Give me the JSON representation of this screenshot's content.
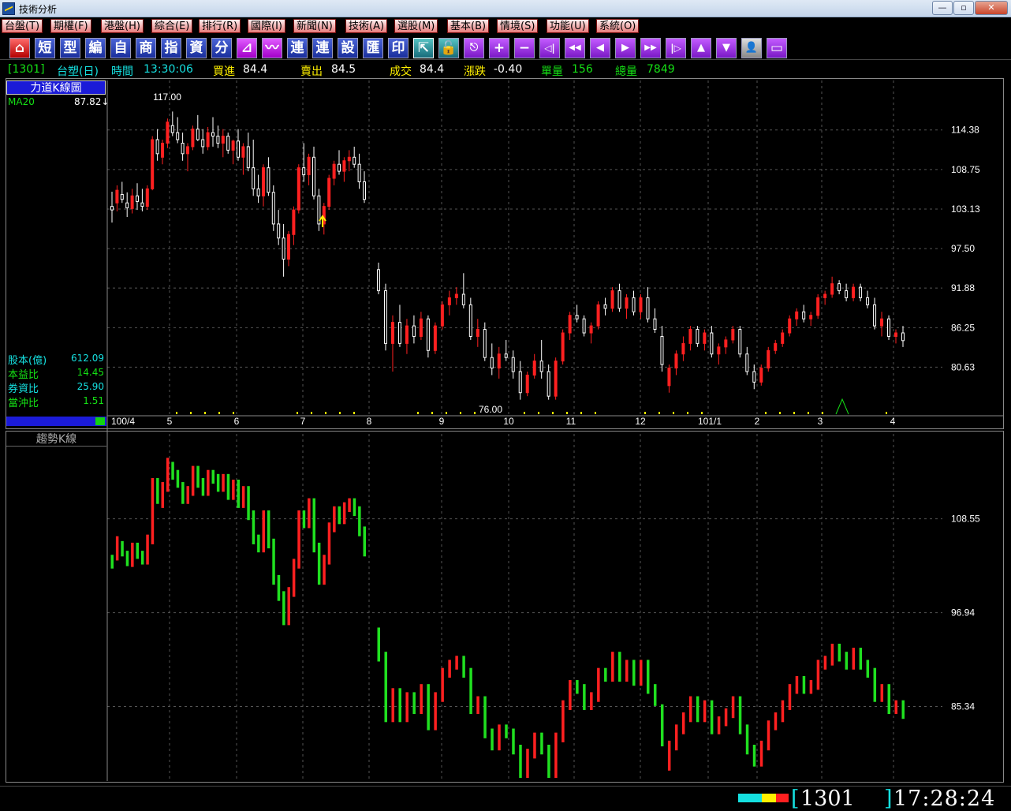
{
  "window": {
    "title": "技術分析",
    "btn_min": "—",
    "btn_max": "▫",
    "btn_close": "✕"
  },
  "menu": [
    "台盤(T)",
    "期權(F)",
    "港盤(H)",
    "綜合(E)",
    "排行(R)",
    "國際(I)",
    "新聞(N)",
    "技術(A)",
    "選股(M)",
    "基本(B)",
    "情境(S)",
    "功能(U)",
    "系統(O)"
  ],
  "toolbar": {
    "home_icon": "⌂",
    "short": "短",
    "type": "型",
    "edit": "編",
    "self": "自",
    "biz": "商",
    "index": "指",
    "capital": "資",
    "split": "分",
    "chart_icon": "⊿",
    "wave_icon": "〰",
    "link1": "連",
    "link2": "連",
    "setting": "設",
    "export": "匯",
    "print": "印",
    "restore_icon": "⇱",
    "lock_icon": "🔓",
    "esc_icon": "⎋",
    "zoom_in": "+",
    "zoom_out": "−",
    "first": "◁|",
    "fast_back": "◀◀",
    "back": "◀",
    "fwd": "▶",
    "fast_fwd": "▶▶",
    "last": "|▷",
    "up": "▲",
    "down": "▼",
    "person_icon": "👤",
    "window_icon": "▭"
  },
  "quote": {
    "code_bracket": "[1301]",
    "name": "台塑(日)",
    "time_label": "時間",
    "time": "13:30:06",
    "bid_label": "買進",
    "bid": "84.4",
    "ask_label": "賣出",
    "ask": "84.5",
    "deal_label": "成交",
    "deal": "84.4",
    "change_label": "漲跌",
    "change": "-0.40",
    "vol_label": "單量",
    "vol": "156",
    "total_label": "總量",
    "total": "7849"
  },
  "upper": {
    "title": "力道K線圖",
    "ma_label": "MA20",
    "ma_value": "87.82↓",
    "stats": [
      {
        "label": "股本(億)",
        "value": "612.09"
      },
      {
        "label": "本益比",
        "value": "14.45"
      },
      {
        "label": "券資比",
        "value": "25.90"
      },
      {
        "label": "當沖比",
        "value": "1.51"
      }
    ]
  },
  "lower": {
    "title": "趨勢K線"
  },
  "status": {
    "code": "1301",
    "time": "17:28:24",
    "bracket_open": "[",
    "bracket_close": "]"
  },
  "colors": {
    "up": "#ff2020",
    "down": "#ffffff",
    "trend_down": "#20e020",
    "ma": "#15e015",
    "grid": "#555555",
    "axis_text": "#ffffff"
  },
  "chart_data": [
    {
      "type": "candlestick",
      "title": "力道K線圖",
      "ylim": [
        74.5,
        119.4
      ],
      "yticks": [
        114.38,
        108.75,
        103.13,
        97.5,
        91.88,
        86.25,
        80.63
      ],
      "ytick_labels": [
        "114.38",
        "108.75",
        "103.13",
        "97.50",
        "91.88",
        "86.25",
        "80.63"
      ],
      "xticks": [
        "100/4",
        "5",
        "6",
        "7",
        "8",
        "9",
        "10",
        "11",
        "12",
        "101/1",
        "2",
        "3",
        "4"
      ],
      "annotations": [
        {
          "text": "117.00",
          "x": "100/5",
          "y": 117.0
        },
        {
          "text": "76.00",
          "x": "100/10",
          "y": 76.0
        }
      ],
      "series": [
        {
          "name": "MA20",
          "last": 87.82
        }
      ],
      "ohlc_approx": [
        [
          103.5,
          105.6,
          101.2,
          103.0
        ],
        [
          104.0,
          106.5,
          102.8,
          105.8
        ],
        [
          105.2,
          107.0,
          104.0,
          104.5
        ],
        [
          104.0,
          105.5,
          102.0,
          103.3
        ],
        [
          103.2,
          106.0,
          102.5,
          105.0
        ],
        [
          105.0,
          106.8,
          103.0,
          104.2
        ],
        [
          104.0,
          106.0,
          102.8,
          103.5
        ],
        [
          103.5,
          106.5,
          103.0,
          106.0
        ],
        [
          106.0,
          113.5,
          105.8,
          113.0
        ],
        [
          113.0,
          114.5,
          110.0,
          111.0
        ],
        [
          110.5,
          113.0,
          109.5,
          112.5
        ],
        [
          112.5,
          116.0,
          111.8,
          115.5
        ],
        [
          115.0,
          117.0,
          113.5,
          114.0
        ],
        [
          114.0,
          116.2,
          112.5,
          113.0
        ],
        [
          112.5,
          114.0,
          110.0,
          111.0
        ],
        [
          111.0,
          112.5,
          108.5,
          112.0
        ],
        [
          112.0,
          115.0,
          111.5,
          114.5
        ],
        [
          114.5,
          116.5,
          112.8,
          113.0
        ],
        [
          113.0,
          114.5,
          111.0,
          112.0
        ],
        [
          112.0,
          114.8,
          111.5,
          114.0
        ],
        [
          114.0,
          116.2,
          112.0,
          113.5
        ],
        [
          113.5,
          115.0,
          111.8,
          112.5
        ],
        [
          112.5,
          114.5,
          110.5,
          113.5
        ],
        [
          113.5,
          114.0,
          111.0,
          111.5
        ],
        [
          111.5,
          113.0,
          109.5,
          112.8
        ],
        [
          112.8,
          114.5,
          110.0,
          110.5
        ],
        [
          110.5,
          112.5,
          108.0,
          112.0
        ],
        [
          112.0,
          114.0,
          108.5,
          109.0
        ],
        [
          109.0,
          113.0,
          105.0,
          106.0
        ],
        [
          106.0,
          108.0,
          104.0,
          105.0
        ],
        [
          105.0,
          109.5,
          103.5,
          109.0
        ],
        [
          109.0,
          110.5,
          105.0,
          105.5
        ],
        [
          105.5,
          106.5,
          100.0,
          101.0
        ],
        [
          101.0,
          103.0,
          98.0,
          99.0
        ],
        [
          99.0,
          101.0,
          93.5,
          96.0
        ],
        [
          96.0,
          100.0,
          95.0,
          99.5
        ],
        [
          99.5,
          103.5,
          98.0,
          103.0
        ],
        [
          103.0,
          109.5,
          102.5,
          109.0
        ],
        [
          109.0,
          112.5,
          107.0,
          108.0
        ],
        [
          108.0,
          111.0,
          106.5,
          110.5
        ],
        [
          110.5,
          112.0,
          104.5,
          105.0
        ],
        [
          105.0,
          106.0,
          100.0,
          101.0
        ],
        [
          101.0,
          104.0,
          99.5,
          103.5
        ],
        [
          103.5,
          108.0,
          103.0,
          107.5
        ],
        [
          107.5,
          110.0,
          106.5,
          109.5
        ],
        [
          109.5,
          111.5,
          108.0,
          108.5
        ],
        [
          108.5,
          110.5,
          107.0,
          110.0
        ],
        [
          110.0,
          111.5,
          108.5,
          110.5
        ],
        [
          110.5,
          112.0,
          109.0,
          109.5
        ],
        [
          109.5,
          111.0,
          106.0,
          107.0
        ],
        [
          107.0,
          108.5,
          104.0,
          104.5
        ],
        [
          94.5,
          95.5,
          91.0,
          91.5
        ],
        [
          91.5,
          92.5,
          83.0,
          84.0
        ],
        [
          84.0,
          88.0,
          80.0,
          87.0
        ],
        [
          87.0,
          89.5,
          83.5,
          84.0
        ],
        [
          84.0,
          87.5,
          82.5,
          86.5
        ],
        [
          86.5,
          88.0,
          84.0,
          85.0
        ],
        [
          85.0,
          88.5,
          84.5,
          87.5
        ],
        [
          87.5,
          88.0,
          82.0,
          83.0
        ],
        [
          83.0,
          87.0,
          82.5,
          86.5
        ],
        [
          86.5,
          90.0,
          86.0,
          89.5
        ],
        [
          89.5,
          91.5,
          88.0,
          90.5
        ],
        [
          90.5,
          92.0,
          89.5,
          91.0
        ],
        [
          91.0,
          94.0,
          89.0,
          89.5
        ],
        [
          89.5,
          90.5,
          84.5,
          85.0
        ],
        [
          85.0,
          87.5,
          83.5,
          86.0
        ],
        [
          86.0,
          87.0,
          81.5,
          82.0
        ],
        [
          82.0,
          84.0,
          79.5,
          80.5
        ],
        [
          80.5,
          83.5,
          79.0,
          82.5
        ],
        [
          82.5,
          84.5,
          81.5,
          82.0
        ],
        [
          82.0,
          83.0,
          79.0,
          80.0
        ],
        [
          80.0,
          81.5,
          76.0,
          77.0
        ],
        [
          77.0,
          80.0,
          76.5,
          79.5
        ],
        [
          79.5,
          82.5,
          79.0,
          81.5
        ],
        [
          81.5,
          84.5,
          79.0,
          80.0
        ],
        [
          80.0,
          81.0,
          76.0,
          76.5
        ],
        [
          76.5,
          82.0,
          76.0,
          81.5
        ],
        [
          81.5,
          86.0,
          81.0,
          85.5
        ],
        [
          85.5,
          88.5,
          84.5,
          88.0
        ],
        [
          88.0,
          89.5,
          87.0,
          87.5
        ],
        [
          87.5,
          88.0,
          85.0,
          85.5
        ],
        [
          85.5,
          87.0,
          84.0,
          86.5
        ],
        [
          86.5,
          90.0,
          86.0,
          89.5
        ],
        [
          89.5,
          90.5,
          88.0,
          89.0
        ],
        [
          89.0,
          92.0,
          88.5,
          91.5
        ],
        [
          91.5,
          92.5,
          88.5,
          89.0
        ],
        [
          89.0,
          91.0,
          87.5,
          90.5
        ],
        [
          90.5,
          91.5,
          88.0,
          88.5
        ],
        [
          88.5,
          91.0,
          87.5,
          90.5
        ],
        [
          90.5,
          92.0,
          87.0,
          87.5
        ],
        [
          87.5,
          89.0,
          85.5,
          86.0
        ],
        [
          85.0,
          86.5,
          80.0,
          81.0
        ],
        [
          78.0,
          81.0,
          77.0,
          80.5
        ],
        [
          80.5,
          83.0,
          79.5,
          82.5
        ],
        [
          82.5,
          85.0,
          81.5,
          84.0
        ],
        [
          84.0,
          86.5,
          83.0,
          86.0
        ],
        [
          86.0,
          86.5,
          83.5,
          84.0
        ],
        [
          84.0,
          86.0,
          83.0,
          85.5
        ],
        [
          85.5,
          86.5,
          82.0,
          82.5
        ],
        [
          82.5,
          84.0,
          81.0,
          83.5
        ],
        [
          83.5,
          85.0,
          82.5,
          84.5
        ],
        [
          84.5,
          86.5,
          84.0,
          86.0
        ],
        [
          86.0,
          86.5,
          82.0,
          82.5
        ],
        [
          82.5,
          83.5,
          79.5,
          80.0
        ],
        [
          80.0,
          81.0,
          77.5,
          78.5
        ],
        [
          78.5,
          81.0,
          78.0,
          80.5
        ],
        [
          80.5,
          83.5,
          80.0,
          83.0
        ],
        [
          83.0,
          84.5,
          82.5,
          84.0
        ],
        [
          84.0,
          86.0,
          83.5,
          85.5
        ],
        [
          85.5,
          88.0,
          85.0,
          87.5
        ],
        [
          87.5,
          89.0,
          86.5,
          88.5
        ],
        [
          88.5,
          89.5,
          87.0,
          87.5
        ],
        [
          87.5,
          88.5,
          86.5,
          88.0
        ],
        [
          88.0,
          91.0,
          87.5,
          90.5
        ],
        [
          90.5,
          91.5,
          89.5,
          91.0
        ],
        [
          91.0,
          93.5,
          90.5,
          92.5
        ],
        [
          92.5,
          93.0,
          91.0,
          91.5
        ],
        [
          91.5,
          92.5,
          90.0,
          90.5
        ],
        [
          90.5,
          92.5,
          90.0,
          92.0
        ],
        [
          92.0,
          92.5,
          90.0,
          90.5
        ],
        [
          90.5,
          91.5,
          89.0,
          89.5
        ],
        [
          89.5,
          90.5,
          86.0,
          86.5
        ],
        [
          86.5,
          88.5,
          85.0,
          87.5
        ],
        [
          87.5,
          88.0,
          84.5,
          85.0
        ],
        [
          85.0,
          86.0,
          84.0,
          85.5
        ],
        [
          85.5,
          86.5,
          83.5,
          84.4
        ]
      ]
    },
    {
      "type": "bar",
      "title": "趨勢K線",
      "ylim": [
        76.5,
        117.5
      ],
      "yticks": [
        108.55,
        96.94,
        85.34
      ],
      "ytick_labels": [
        "108.55",
        "96.94",
        "85.34"
      ]
    }
  ]
}
